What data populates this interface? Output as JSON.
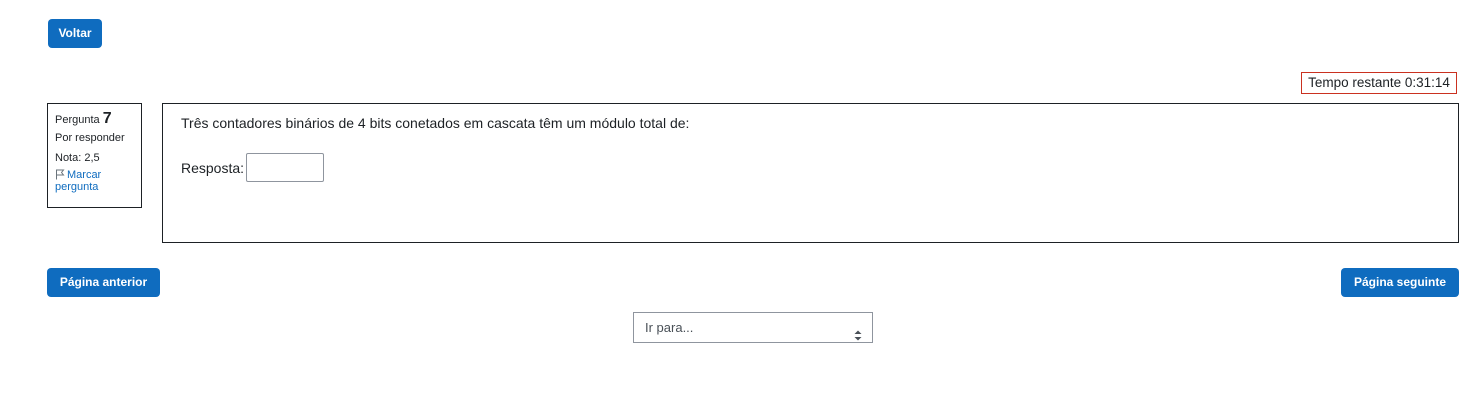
{
  "nav": {
    "back_label": "Voltar"
  },
  "timer": {
    "text": "Tempo restante 0:31:14"
  },
  "question_info": {
    "label": "Pergunta",
    "number": "7",
    "state": "Por responder",
    "grade": "Nota: 2,5",
    "flag_label": "Marcar pergunta",
    "flag_icon": "flag-outline-icon"
  },
  "question": {
    "text": "Três contadores binários de 4 bits conetados em cascata têm um módulo total de:",
    "answer_label": "Resposta:",
    "answer_value": "",
    "answer_placeholder": ""
  },
  "pagination": {
    "prev_label": "Página anterior",
    "next_label": "Página seguinte"
  },
  "jump_select": {
    "selected": "Ir para...",
    "icon": "select-arrows-icon"
  },
  "colors": {
    "primary": "#0f6cbf",
    "timer_border": "#ca3120",
    "text": "#1d2125"
  }
}
